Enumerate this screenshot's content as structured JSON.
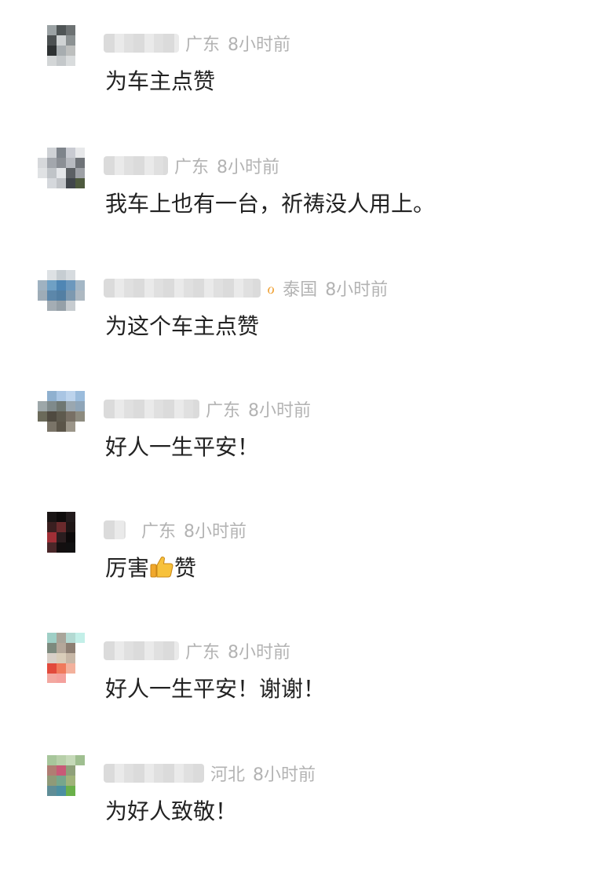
{
  "comments": [
    {
      "region": "广东",
      "time": "8小时前",
      "text": "为车主点赞"
    },
    {
      "region": "广东",
      "time": "8小时前",
      "text": "我车上也有一台，祈祷没人用上。"
    },
    {
      "region": "泰国",
      "time": "8小时前",
      "text": "为这个车主点赞",
      "badge_icon": "ribbon-icon"
    },
    {
      "region": "广东",
      "time": "8小时前",
      "text": "好人一生平安！"
    },
    {
      "region": "广东",
      "time": "8小时前",
      "text_before": "厉害",
      "text_after": "赞",
      "emoji": "thumbs-up-icon"
    },
    {
      "region": "广东",
      "time": "8小时前",
      "text": "好人一生平安！谢谢！"
    },
    {
      "region": "河北",
      "time": "8小时前",
      "text": "为好人致敬！"
    }
  ],
  "colors": {
    "region_time": "#b3b3b3",
    "text": "#222222",
    "badge": "#f0a43c",
    "thumb": "#f5b82e"
  }
}
